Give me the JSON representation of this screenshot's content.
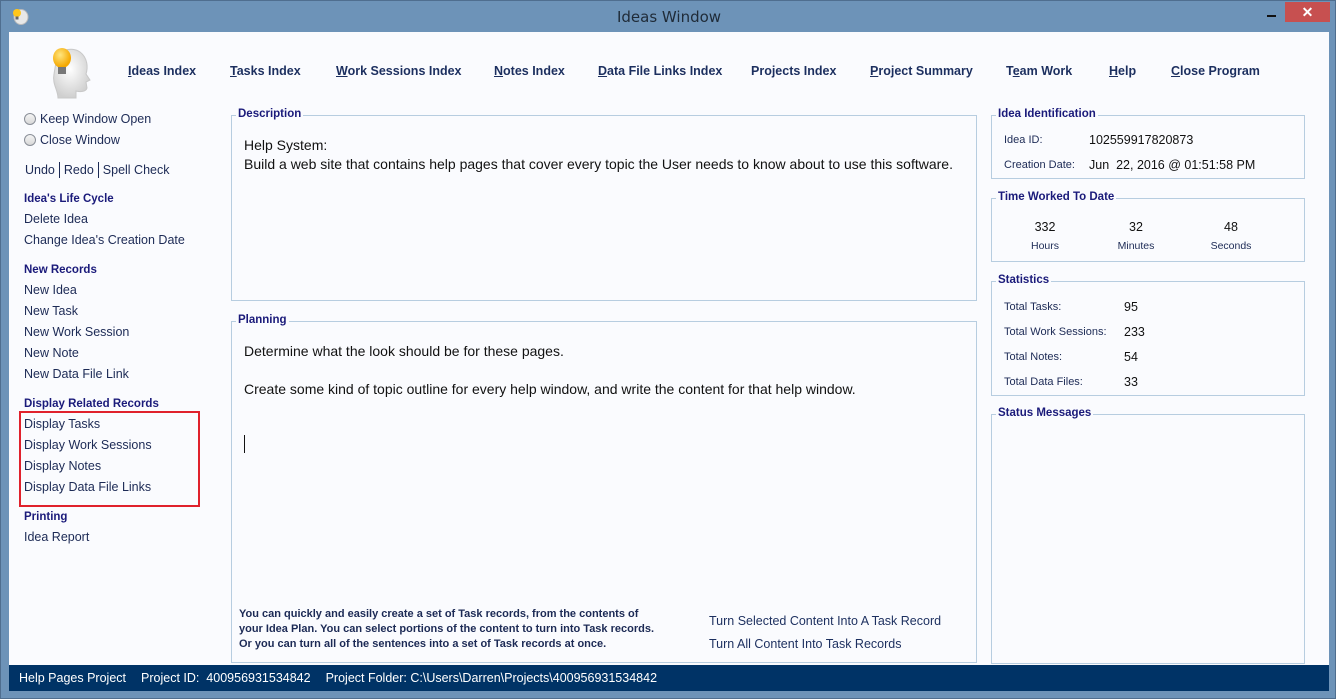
{
  "window": {
    "title": "Ideas Window",
    "minimize_label": "–",
    "close_label": "✕"
  },
  "nav": {
    "items": [
      {
        "label": "Ideas Index",
        "mnemonic": "I"
      },
      {
        "label": "Tasks Index",
        "mnemonic": "T"
      },
      {
        "label": "Work Sessions Index",
        "mnemonic": "W"
      },
      {
        "label": "Notes Index",
        "mnemonic": "N"
      },
      {
        "label": "Data File Links Index",
        "mnemonic": "D"
      },
      {
        "label": "Projects Index",
        "mnemonic": ""
      },
      {
        "label": "Project Summary",
        "mnemonic": "P"
      },
      {
        "label": "Team Work",
        "mnemonic": "e"
      },
      {
        "label": "Help",
        "mnemonic": "H"
      },
      {
        "label": "Close Program",
        "mnemonic": "C"
      }
    ]
  },
  "sidebar": {
    "keep_open": "Keep Window Open",
    "close_window": "Close Window",
    "undo": "Undo",
    "redo": "Redo",
    "spell_check": "Spell Check",
    "sections": [
      {
        "heading": "Idea's Life Cycle",
        "items": [
          "Delete Idea",
          "Change Idea's Creation Date"
        ]
      },
      {
        "heading": "New Records",
        "items": [
          "New Idea",
          "New Task",
          "New Work Session",
          "New Note",
          "New Data File Link"
        ]
      },
      {
        "heading": "Display Related Records",
        "items": [
          "Display Tasks",
          "Display Work Sessions",
          "Display Notes",
          "Display Data File Links"
        ]
      },
      {
        "heading": "Printing",
        "items": [
          "Idea Report"
        ]
      }
    ]
  },
  "description": {
    "label": "Description",
    "line1": "Help System:",
    "line2": "Build a web site that contains help pages that cover every topic the User needs to know about to use this software."
  },
  "planning": {
    "label": "Planning",
    "line1": "Determine what the look should be for these pages.",
    "line2": "Create some kind of topic outline for every help window, and write the content for that help window.",
    "info_line1": "You can quickly and easily create a set of Task records, from the contents of",
    "info_line2": "your Idea Plan. You can select portions of the content to turn into Task records.",
    "info_line3": "Or you can turn all of the sentences into a set of Task records at once.",
    "turn_selected": "Turn Selected Content Into A Task Record",
    "turn_all": "Turn All Content Into Task Records"
  },
  "identification": {
    "label": "Idea Identification",
    "id_label": "Idea ID:",
    "id_value": "102559917820873",
    "date_label": "Creation Date:",
    "date_value": "Jun  22, 2016 @ 01:51:58 PM"
  },
  "time_worked": {
    "label": "Time Worked To Date",
    "hours": "332",
    "hours_label": "Hours",
    "minutes": "32",
    "minutes_label": "Minutes",
    "seconds": "48",
    "seconds_label": "Seconds"
  },
  "statistics": {
    "label": "Statistics",
    "rows": [
      {
        "label": "Total Tasks:",
        "value": "95"
      },
      {
        "label": "Total Work Sessions:",
        "value": "233"
      },
      {
        "label": "Total Notes:",
        "value": "54"
      },
      {
        "label": "Total Data Files:",
        "value": "33"
      }
    ]
  },
  "status_messages": {
    "label": "Status Messages"
  },
  "statusbar": {
    "project_name": "Help Pages Project",
    "project_id": "Project ID:  400956931534842",
    "project_folder": "Project Folder: C:\\Users\\Darren\\Projects\\400956931534842"
  },
  "colors": {
    "title_bar": "#6d93b8",
    "close_button": "#c75050",
    "status_bar": "#003366",
    "heading": "#1a1a7a",
    "highlight": "#e0212c"
  }
}
